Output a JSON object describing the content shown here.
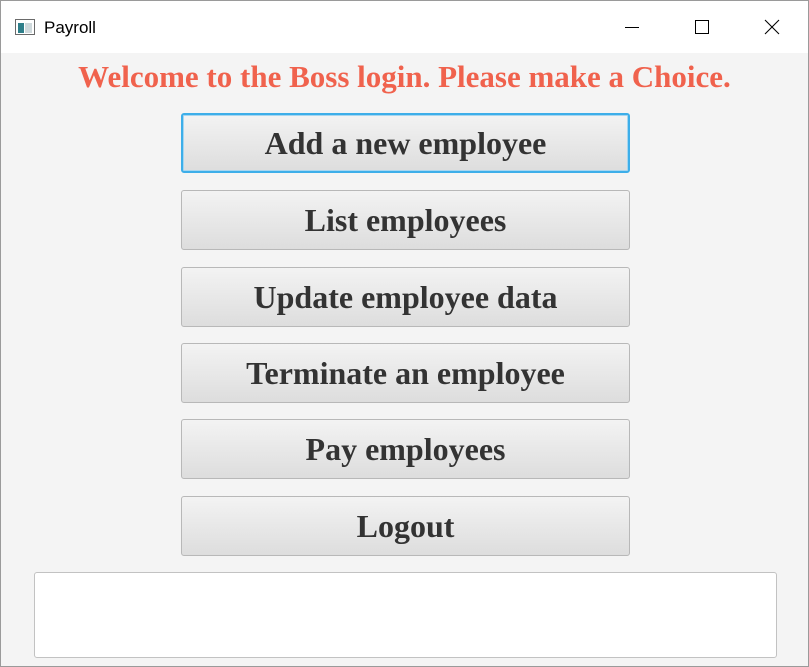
{
  "window": {
    "title": "Payroll",
    "app_icon": "application-window-icon",
    "controls": {
      "minimize_icon": "minimize-icon",
      "maximize_icon": "maximize-icon",
      "close_icon": "close-icon"
    }
  },
  "header": {
    "text": "Welcome to the Boss login. Please make a Choice.",
    "color": "#f0624d"
  },
  "menu": {
    "buttons": [
      {
        "label": "Add a new employee",
        "focused": true
      },
      {
        "label": "List employees"
      },
      {
        "label": "Update employee data"
      },
      {
        "label": "Terminate an employee"
      },
      {
        "label": "Pay employees"
      },
      {
        "label": "Logout"
      }
    ]
  },
  "output": {
    "value": "",
    "placeholder": ""
  },
  "colors": {
    "focus_ring": "#3daee9",
    "background": "#f4f4f4",
    "button_text": "#333333"
  }
}
